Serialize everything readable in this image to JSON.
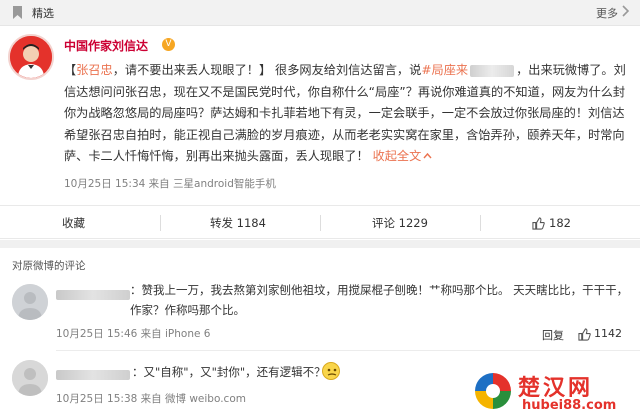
{
  "topbar": {
    "label": "精选",
    "more": "更多"
  },
  "post": {
    "author": "中国作家刘信达",
    "verified_badge": "V",
    "mention": "张召忠",
    "line1_a": "，请不要出来丢人现眼了！】 很多网友给刘信达留言，说",
    "topic": "#局座来",
    "line1_b": "，出来玩微博了。",
    "body": "刘信达想问问张召忠，现在又不是国民党时代，你自称什么“局座”？再说你难道真的不知道，网友为什么封你为战略忽悠局的局座吗？萨达姆和卡扎菲若地下有灵，一定会联手，一定不会放过你张局座的！刘信达希望张召忠自拍时，能正视自己满脸的岁月痕迹，从而老老实实窝在家里，含饴弄孙，颐养天年，时常向萨、卡二人忏悔忏悔，别再出来抛头露面，丢人现眼了！",
    "expand": "收起全文",
    "timestamp": "10月25日 15:34",
    "source": "来自 三星android智能手机"
  },
  "actions": {
    "favorite": "收藏",
    "repost": "转发 1184",
    "comment": "评论 1229",
    "like": "182"
  },
  "comments": {
    "title": "对原微博的评论",
    "items": [
      {
        "text": "：赞我上一万，我去熬第刘家刨他祖坟，用搅屎棍子刨晚！艹称吗那个比。 天天瞎比比，干干干，作家？作称吗那个比。",
        "timestamp": "10月25日 15:46",
        "source": "来自 iPhone 6",
        "reply": "回复",
        "likes": "1142"
      },
      {
        "text": "：又\"自称\"，又\"封你\"，还有逻辑不？",
        "timestamp": "10月25日 15:38",
        "source": "来自 微博 weibo.com"
      }
    ]
  },
  "watermark": {
    "name": "楚汉网",
    "url": "hubei88.com"
  },
  "colors": {
    "accent": "#eb7350",
    "brand": "#e4322b"
  }
}
